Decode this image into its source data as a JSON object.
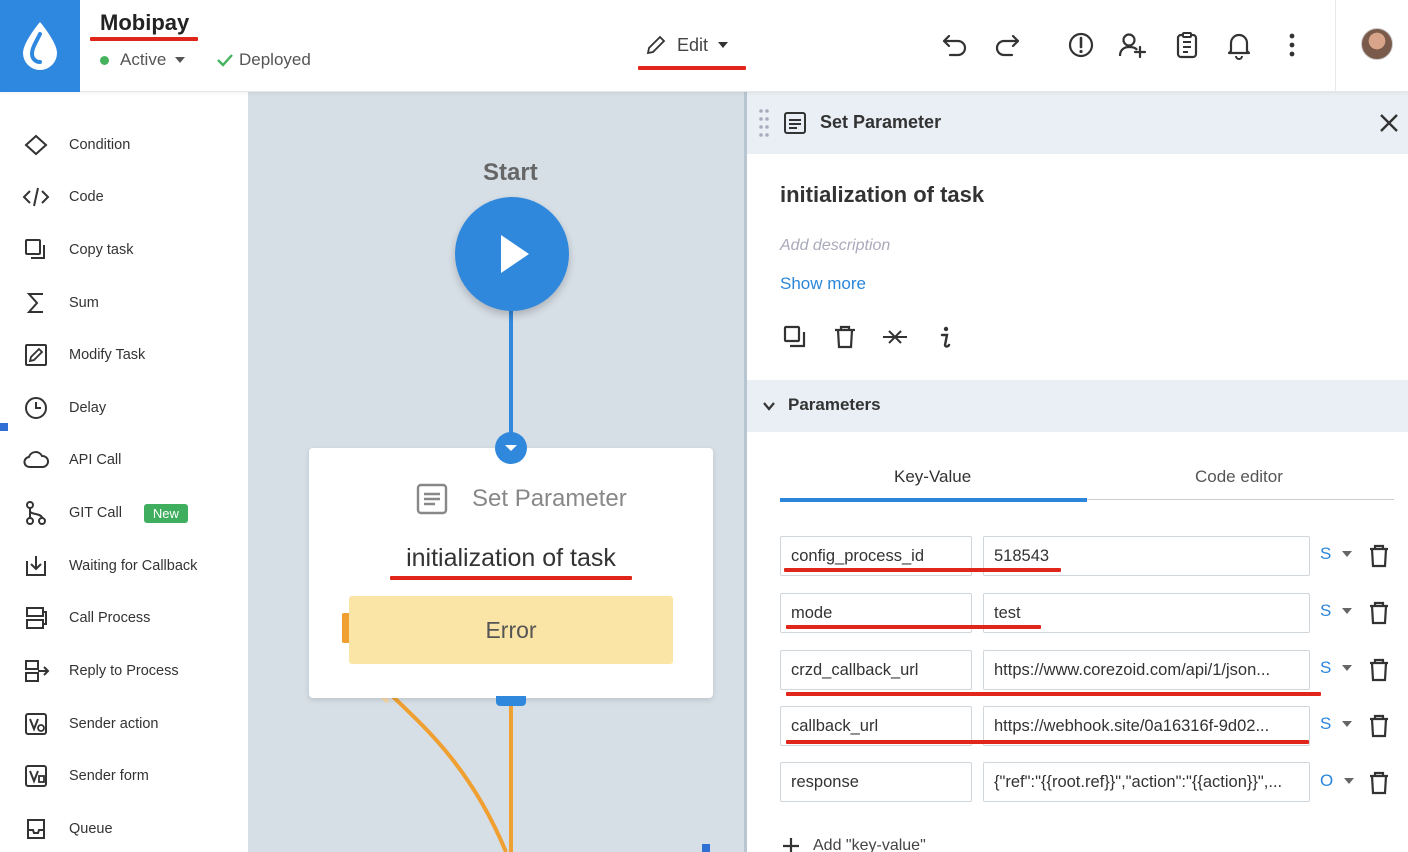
{
  "header": {
    "app_title": "Mobipay",
    "status_label": "Active",
    "deploy_label": "Deployed",
    "edit_label": "Edit"
  },
  "sidebar": {
    "items": [
      {
        "label": "Condition",
        "icon": "diamond-icon"
      },
      {
        "label": "Code",
        "icon": "code-icon"
      },
      {
        "label": "Copy task",
        "icon": "copy-icon"
      },
      {
        "label": "Sum",
        "icon": "sigma-icon"
      },
      {
        "label": "Modify Task",
        "icon": "edit-square-icon"
      },
      {
        "label": "Delay",
        "icon": "clock-icon"
      },
      {
        "label": "API Call",
        "icon": "cloud-icon"
      },
      {
        "label": "GIT Call",
        "icon": "git-icon",
        "badge": "New"
      },
      {
        "label": "Waiting for Callback",
        "icon": "download-tray-icon"
      },
      {
        "label": "Call Process",
        "icon": "call-process-icon"
      },
      {
        "label": "Reply to Process",
        "icon": "reply-process-icon"
      },
      {
        "label": "Sender action",
        "icon": "sender-action-icon"
      },
      {
        "label": "Sender form",
        "icon": "sender-form-icon"
      },
      {
        "label": "Queue",
        "icon": "queue-icon"
      }
    ]
  },
  "canvas": {
    "start_label": "Start",
    "node_type": "Set Parameter",
    "node_name": "initialization of task",
    "error_label": "Error"
  },
  "panel": {
    "title": "Set Parameter",
    "task_name": "initialization of task",
    "description_placeholder": "Add description",
    "show_more": "Show more",
    "params_title": "Parameters",
    "tabs": [
      "Key-Value",
      "Code editor"
    ],
    "params": [
      {
        "key": "config_process_id",
        "value": "518543",
        "type": "S"
      },
      {
        "key": "mode",
        "value": "test",
        "type": "S"
      },
      {
        "key": "crzd_callback_url",
        "value": "https://www.corezoid.com/api/1/json...",
        "type": "S"
      },
      {
        "key": "callback_url",
        "value": "https://webhook.site/0a16316f-9d02...",
        "type": "S"
      },
      {
        "key": "response",
        "value": "{\"ref\":\"{{root.ref}}\",\"action\":\"{{action}}\",...",
        "type": "O"
      }
    ],
    "add_kv_label": "Add \"key-value\""
  },
  "colors": {
    "brand_blue": "#2f88e0",
    "accent_red": "#e0261b",
    "active_green": "#45b35e",
    "link_blue": "#2b86d9",
    "error_fill": "#fbe5a6",
    "flow_orange": "#f0a030"
  }
}
